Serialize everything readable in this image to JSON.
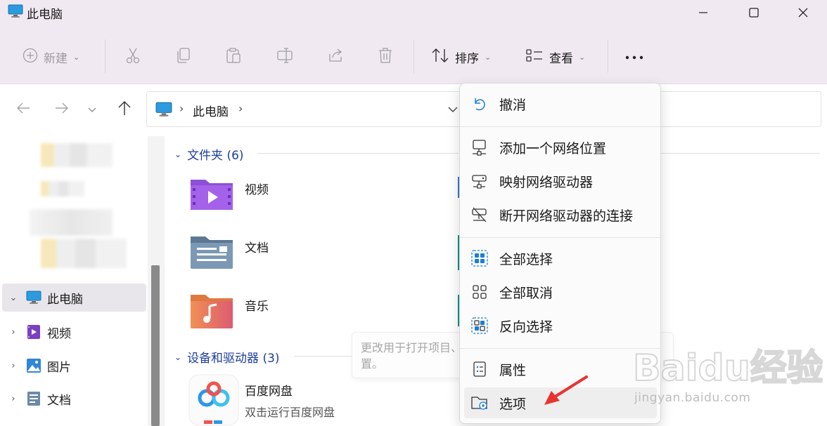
{
  "window": {
    "title": "此电脑"
  },
  "toolbar": {
    "new_label": "新建",
    "sort_label": "排序",
    "view_label": "查看"
  },
  "address": {
    "location": "此电脑"
  },
  "sidebar": {
    "items": [
      {
        "label": "此电脑"
      },
      {
        "label": "视频"
      },
      {
        "label": "图片"
      },
      {
        "label": "文档"
      }
    ]
  },
  "main": {
    "folders_header": "文件夹 (6)",
    "folders": [
      {
        "name": "视频"
      },
      {
        "name": "文档"
      },
      {
        "name": "音乐"
      }
    ],
    "devices_header": "设备和驱动器 (3)",
    "devices": [
      {
        "name": "百度网盘",
        "subtitle": "双击运行百度网盘"
      }
    ]
  },
  "menu": {
    "items": [
      {
        "label": "撤消"
      },
      {
        "label": "添加一个网络位置"
      },
      {
        "label": "映射网络驱动器"
      },
      {
        "label": "断开网络驱动器的连接"
      },
      {
        "label": "全部选择"
      },
      {
        "label": "全部取消"
      },
      {
        "label": "反向选择"
      },
      {
        "label": "属性"
      },
      {
        "label": "选项"
      }
    ]
  },
  "tooltip": {
    "text": "更改用于打开项目、文件和文件夹视图以及搜索等方面的设置。"
  },
  "watermark": {
    "text": "Baidu经验",
    "sub": "jingyan.baidu.com"
  },
  "colors": {
    "accent": "#1d3e9e",
    "annotation_arrow": "#e8342f",
    "titlebar": "#f1e9f2"
  }
}
